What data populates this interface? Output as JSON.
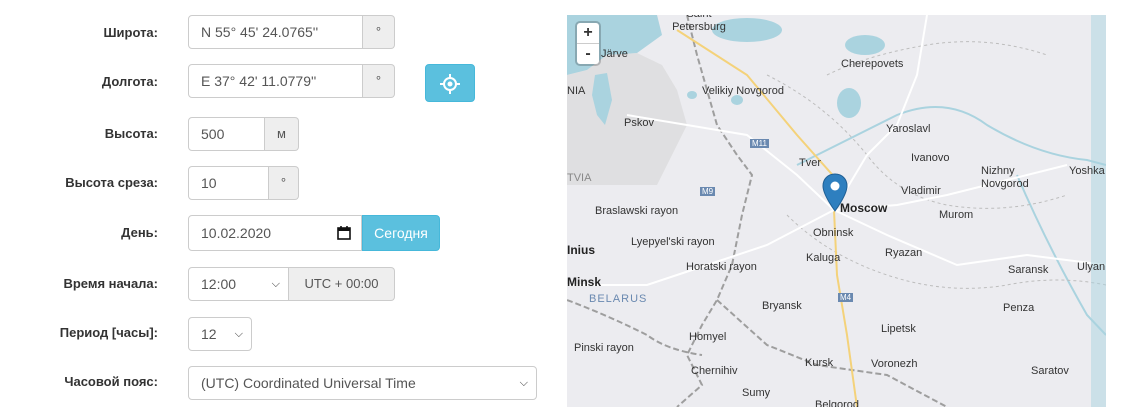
{
  "form": {
    "latitude": {
      "label": "Широта:",
      "value": "N 55° 45' 24.0765''",
      "unit": "°"
    },
    "longitude": {
      "label": "Долгота:",
      "value": "E 37° 42' 11.0779''",
      "unit": "°",
      "locate_icon": "crosshair-icon"
    },
    "altitude": {
      "label": "Высота:",
      "value": "500",
      "unit": "м"
    },
    "cut_height": {
      "label": "Высота среза:",
      "value": "10",
      "unit": "°"
    },
    "day": {
      "label": "День:",
      "value": "10.02.2020",
      "calendar_icon": "calendar-icon",
      "today_button": "Сегодня"
    },
    "start_time": {
      "label": "Время начала:",
      "value": "12:00",
      "utc": "UTC + 00:00"
    },
    "period": {
      "label": "Период [часы]:",
      "value": "12"
    },
    "timezone": {
      "label": "Часовой пояс:",
      "value": "(UTC) Coordinated Universal Time"
    }
  },
  "map": {
    "zoom_in": "+",
    "zoom_out": "-",
    "marker_icon": "map-pin-icon",
    "labels": [
      "Saint Petersburg",
      "Järve",
      "NIA",
      "Cherepovets",
      "Velikiy Novgorod",
      "Pskov",
      "M11",
      "Yaroslavl",
      "Tver",
      "Ivanovo",
      "Nizhny Novgorod",
      "Yoshka",
      "TVIA",
      "M9",
      "Vladimir",
      "Moscow",
      "Braslawski rayon",
      "Murom",
      "Obninsk",
      "Lyepyel'ski rayon",
      "Inius",
      "Ryazan",
      "Kaluga",
      "Horatski rayon",
      "Minsk",
      "Saransk",
      "Ulyan",
      "BELARUS",
      "M4",
      "Bryansk",
      "Penza",
      "Lipetsk",
      "Homyel",
      "Pinski rayon",
      "Kursk",
      "Voronezh",
      "Chernihiv",
      "Saratov",
      "Sumy",
      "Belgorod"
    ]
  }
}
